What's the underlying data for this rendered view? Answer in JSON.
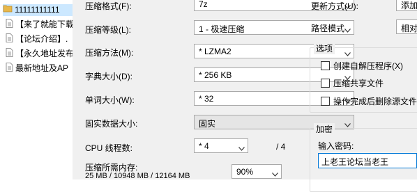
{
  "file_list": [
    {
      "name": "11111111111",
      "selected": true,
      "icon": "folder-icon"
    },
    {
      "name": "【来了就能下载",
      "icon": "text-file-icon"
    },
    {
      "name": "【论坛介绍】.",
      "icon": "text-file-icon"
    },
    {
      "name": "【永久地址发布",
      "icon": "text-file-icon"
    },
    {
      "name": "最新地址及AP",
      "icon": "text-file-icon"
    }
  ],
  "left": {
    "format": {
      "label": "压缩格式(F):",
      "value": "7z"
    },
    "level": {
      "label": "压缩等级(L):",
      "value": "1 - 极速压缩"
    },
    "method": {
      "label": "压缩方法(M):",
      "value": "* LZMA2"
    },
    "dict": {
      "label": "字典大小(D):",
      "value": "* 256 KB"
    },
    "word": {
      "label": "单词大小(W):",
      "value": "* 32"
    },
    "solid": {
      "label": "固实数据大小:",
      "value": "固实"
    },
    "threads": {
      "label": "CPU 线程数:",
      "value": "* 4",
      "max": "/ 4"
    },
    "memory": {
      "label": "压缩所需内存:",
      "usage": "25 MB / 10948 MB / 12164 MB",
      "percent": "90%"
    }
  },
  "right": {
    "update": {
      "label": "更新方式(U):",
      "value": "添加"
    },
    "path": {
      "label": "路径模式",
      "value": "相对"
    },
    "options": {
      "title": "选项",
      "sfx": "创建自解压程序(X)",
      "shared": "压缩共享文件",
      "delete": "操作完成后删除源文件"
    },
    "encryption": {
      "title": "加密",
      "password_label": "输入密码:",
      "password_value": "上老王论坛当老王"
    }
  }
}
